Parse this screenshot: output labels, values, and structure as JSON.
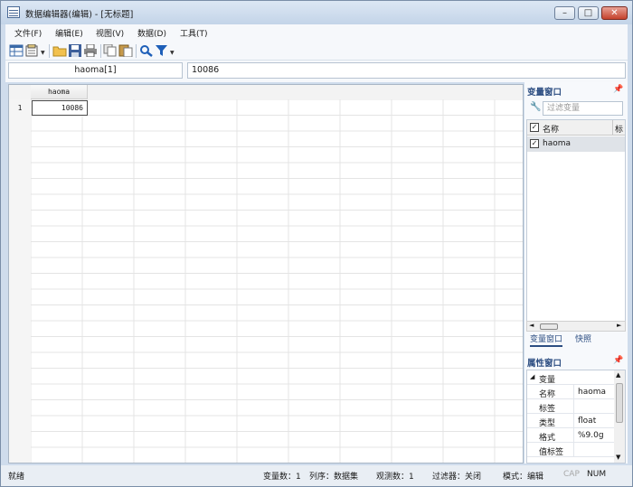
{
  "window": {
    "title": "数据编辑器(编辑) - [无标题]"
  },
  "menu": [
    "文件(F)",
    "编辑(E)",
    "视图(V)",
    "数据(D)",
    "工具(T)"
  ],
  "cellbar": {
    "ref": "haoma[1]",
    "value": "10086"
  },
  "grid": {
    "column_header": "haoma",
    "row_number": "1",
    "cell_value": "10086"
  },
  "variables_pane": {
    "title": "变量窗口",
    "filter_placeholder": "过滤变量",
    "header_name": "名称",
    "header_label": "标",
    "rows": [
      {
        "name": "haoma",
        "checked": true
      }
    ],
    "tabs": [
      "变量窗口",
      "快照"
    ]
  },
  "properties_pane": {
    "title": "属性窗口",
    "group": "变量",
    "rows": [
      {
        "key": "名称",
        "value": "haoma"
      },
      {
        "key": "标签",
        "value": ""
      },
      {
        "key": "类型",
        "value": "float"
      },
      {
        "key": "格式",
        "value": "%9.0g"
      },
      {
        "key": "值标签",
        "value": ""
      }
    ]
  },
  "status": {
    "ready": "就绪",
    "vars": "变量数：1",
    "order": "列序：数据集",
    "obs": "观测数：1",
    "filter": "过滤器：关闭",
    "mode": "模式：编辑",
    "cap": "CAP",
    "num": "NUM"
  },
  "icons": [
    "data-editor-icon",
    "browse-icon",
    "open-icon",
    "save-icon",
    "print-icon",
    "copy-icon",
    "paste-icon",
    "search-icon",
    "filter-icon",
    "wrench-icon",
    "pin-icon",
    "checkbox-icon"
  ],
  "colors": {
    "accent": "#2d4e82",
    "titlebar": "#c3d4e8",
    "close": "#c4412c"
  }
}
